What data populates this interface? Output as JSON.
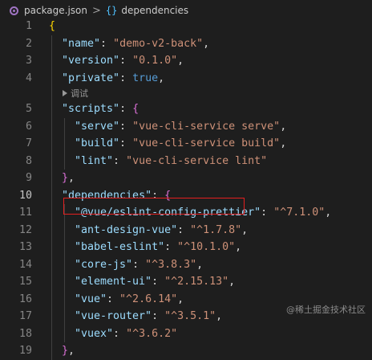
{
  "breadcrumb": {
    "file": "package.json",
    "separator": ">",
    "object_icon": "{}",
    "path": "dependencies"
  },
  "editor": {
    "active_line": 10,
    "codelens": "调试",
    "lines": [
      {
        "n": "1",
        "tokens": [
          {
            "t": "{",
            "c": "t-bracket1"
          }
        ],
        "indent": 0
      },
      {
        "n": "2",
        "tokens": [
          {
            "t": "\"name\"",
            "c": "t-key"
          },
          {
            "t": ": ",
            "c": "t-punc"
          },
          {
            "t": "\"demo-v2-back\"",
            "c": "t-str"
          },
          {
            "t": ",",
            "c": "t-punc"
          }
        ],
        "indent": 1
      },
      {
        "n": "3",
        "tokens": [
          {
            "t": "\"version\"",
            "c": "t-key"
          },
          {
            "t": ": ",
            "c": "t-punc"
          },
          {
            "t": "\"0.1.0\"",
            "c": "t-str"
          },
          {
            "t": ",",
            "c": "t-punc"
          }
        ],
        "indent": 1
      },
      {
        "n": "4",
        "tokens": [
          {
            "t": "\"private\"",
            "c": "t-key"
          },
          {
            "t": ": ",
            "c": "t-punc"
          },
          {
            "t": "true",
            "c": "t-bool"
          },
          {
            "t": ",",
            "c": "t-punc"
          }
        ],
        "indent": 1
      },
      {
        "codelens": true
      },
      {
        "n": "5",
        "tokens": [
          {
            "t": "\"scripts\"",
            "c": "t-key"
          },
          {
            "t": ": ",
            "c": "t-punc"
          },
          {
            "t": "{",
            "c": "t-bracket2"
          }
        ],
        "indent": 1
      },
      {
        "n": "6",
        "tokens": [
          {
            "t": "\"serve\"",
            "c": "t-key"
          },
          {
            "t": ": ",
            "c": "t-punc"
          },
          {
            "t": "\"vue-cli-service serve\"",
            "c": "t-str"
          },
          {
            "t": ",",
            "c": "t-punc"
          }
        ],
        "indent": 2
      },
      {
        "n": "7",
        "tokens": [
          {
            "t": "\"build\"",
            "c": "t-key"
          },
          {
            "t": ": ",
            "c": "t-punc"
          },
          {
            "t": "\"vue-cli-service build\"",
            "c": "t-str"
          },
          {
            "t": ",",
            "c": "t-punc"
          }
        ],
        "indent": 2
      },
      {
        "n": "8",
        "tokens": [
          {
            "t": "\"lint\"",
            "c": "t-key"
          },
          {
            "t": ": ",
            "c": "t-punc"
          },
          {
            "t": "\"vue-cli-service lint\"",
            "c": "t-str"
          }
        ],
        "indent": 2
      },
      {
        "n": "9",
        "tokens": [
          {
            "t": "}",
            "c": "t-bracket2"
          },
          {
            "t": ",",
            "c": "t-punc"
          }
        ],
        "indent": 1
      },
      {
        "n": "10",
        "tokens": [
          {
            "t": "\"dependencies\"",
            "c": "t-key"
          },
          {
            "t": ": ",
            "c": "t-punc"
          },
          {
            "t": "{",
            "c": "t-bracket2"
          }
        ],
        "indent": 1
      },
      {
        "n": "11",
        "tokens": [
          {
            "t": "\"@vue/eslint-config-prettier\"",
            "c": "t-key"
          },
          {
            "t": ": ",
            "c": "t-punc"
          },
          {
            "t": "\"^7.1.0\"",
            "c": "t-str"
          },
          {
            "t": ",",
            "c": "t-punc"
          }
        ],
        "indent": 2
      },
      {
        "n": "12",
        "tokens": [
          {
            "t": "\"ant-design-vue\"",
            "c": "t-key"
          },
          {
            "t": ": ",
            "c": "t-punc"
          },
          {
            "t": "\"^1.7.8\"",
            "c": "t-str"
          },
          {
            "t": ",",
            "c": "t-punc"
          }
        ],
        "indent": 2
      },
      {
        "n": "13",
        "tokens": [
          {
            "t": "\"babel-eslint\"",
            "c": "t-key"
          },
          {
            "t": ": ",
            "c": "t-punc"
          },
          {
            "t": "\"^10.1.0\"",
            "c": "t-str"
          },
          {
            "t": ",",
            "c": "t-punc"
          }
        ],
        "indent": 2
      },
      {
        "n": "14",
        "tokens": [
          {
            "t": "\"core-js\"",
            "c": "t-key"
          },
          {
            "t": ": ",
            "c": "t-punc"
          },
          {
            "t": "\"^3.8.3\"",
            "c": "t-str"
          },
          {
            "t": ",",
            "c": "t-punc"
          }
        ],
        "indent": 2
      },
      {
        "n": "15",
        "tokens": [
          {
            "t": "\"element-ui\"",
            "c": "t-key"
          },
          {
            "t": ": ",
            "c": "t-punc"
          },
          {
            "t": "\"^2.15.13\"",
            "c": "t-str"
          },
          {
            "t": ",",
            "c": "t-punc"
          }
        ],
        "indent": 2
      },
      {
        "n": "16",
        "tokens": [
          {
            "t": "\"vue\"",
            "c": "t-key"
          },
          {
            "t": ": ",
            "c": "t-punc"
          },
          {
            "t": "\"^2.6.14\"",
            "c": "t-str"
          },
          {
            "t": ",",
            "c": "t-punc"
          }
        ],
        "indent": 2
      },
      {
        "n": "17",
        "tokens": [
          {
            "t": "\"vue-router\"",
            "c": "t-key"
          },
          {
            "t": ": ",
            "c": "t-punc"
          },
          {
            "t": "\"^3.5.1\"",
            "c": "t-str"
          },
          {
            "t": ",",
            "c": "t-punc"
          }
        ],
        "indent": 2
      },
      {
        "n": "18",
        "tokens": [
          {
            "t": "\"vuex\"",
            "c": "t-key"
          },
          {
            "t": ": ",
            "c": "t-punc"
          },
          {
            "t": "\"^3.6.2\"",
            "c": "t-str"
          }
        ],
        "indent": 2
      },
      {
        "n": "19",
        "tokens": [
          {
            "t": "}",
            "c": "t-bracket2"
          },
          {
            "t": ",",
            "c": "t-punc"
          }
        ],
        "indent": 1
      }
    ]
  },
  "highlight": {
    "line": "12",
    "color": "#e51f1f"
  },
  "watermark": "@稀土掘金技术社区"
}
